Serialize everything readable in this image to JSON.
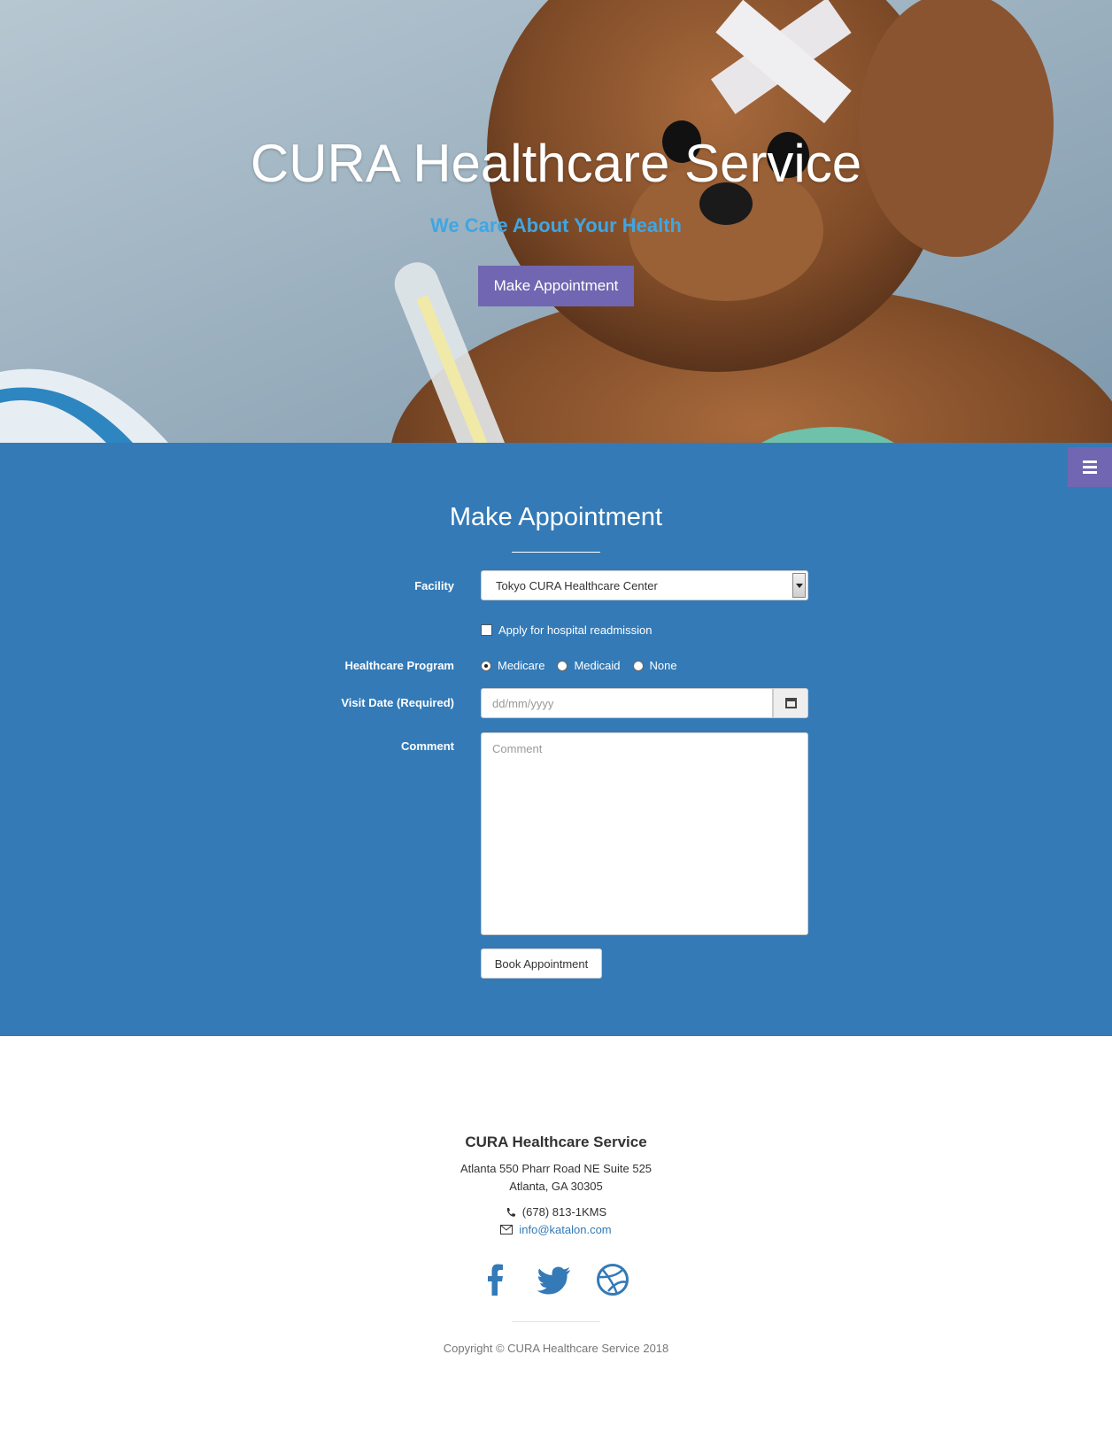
{
  "hero": {
    "title": "CURA Healthcare Service",
    "subtitle": "We Care About Your Health",
    "cta_label": "Make Appointment"
  },
  "appointment": {
    "title": "Make Appointment",
    "facility_label": "Facility",
    "facility_value": "Tokyo CURA Healthcare Center",
    "readmission_label": "Apply for hospital readmission",
    "readmission_checked": false,
    "program_label": "Healthcare Program",
    "programs": [
      {
        "label": "Medicare",
        "selected": true
      },
      {
        "label": "Medicaid",
        "selected": false
      },
      {
        "label": "None",
        "selected": false
      }
    ],
    "visit_date_label": "Visit Date (Required)",
    "visit_date_placeholder": "dd/mm/yyyy",
    "comment_label": "Comment",
    "comment_placeholder": "Comment",
    "book_label": "Book Appointment"
  },
  "footer": {
    "title": "CURA Healthcare Service",
    "address_line1": "Atlanta 550 Pharr Road NE Suite 525",
    "address_line2": "Atlanta, GA 30305",
    "phone": "(678) 813-1KMS",
    "email": "info@katalon.com",
    "socials": [
      "facebook-icon",
      "twitter-icon",
      "dribbble-icon"
    ],
    "copyright": "Copyright © CURA Healthcare Service 2018"
  },
  "colors": {
    "primary": "#337ab7",
    "accent": "#7166b1",
    "subtitle": "#3fa6e3"
  }
}
